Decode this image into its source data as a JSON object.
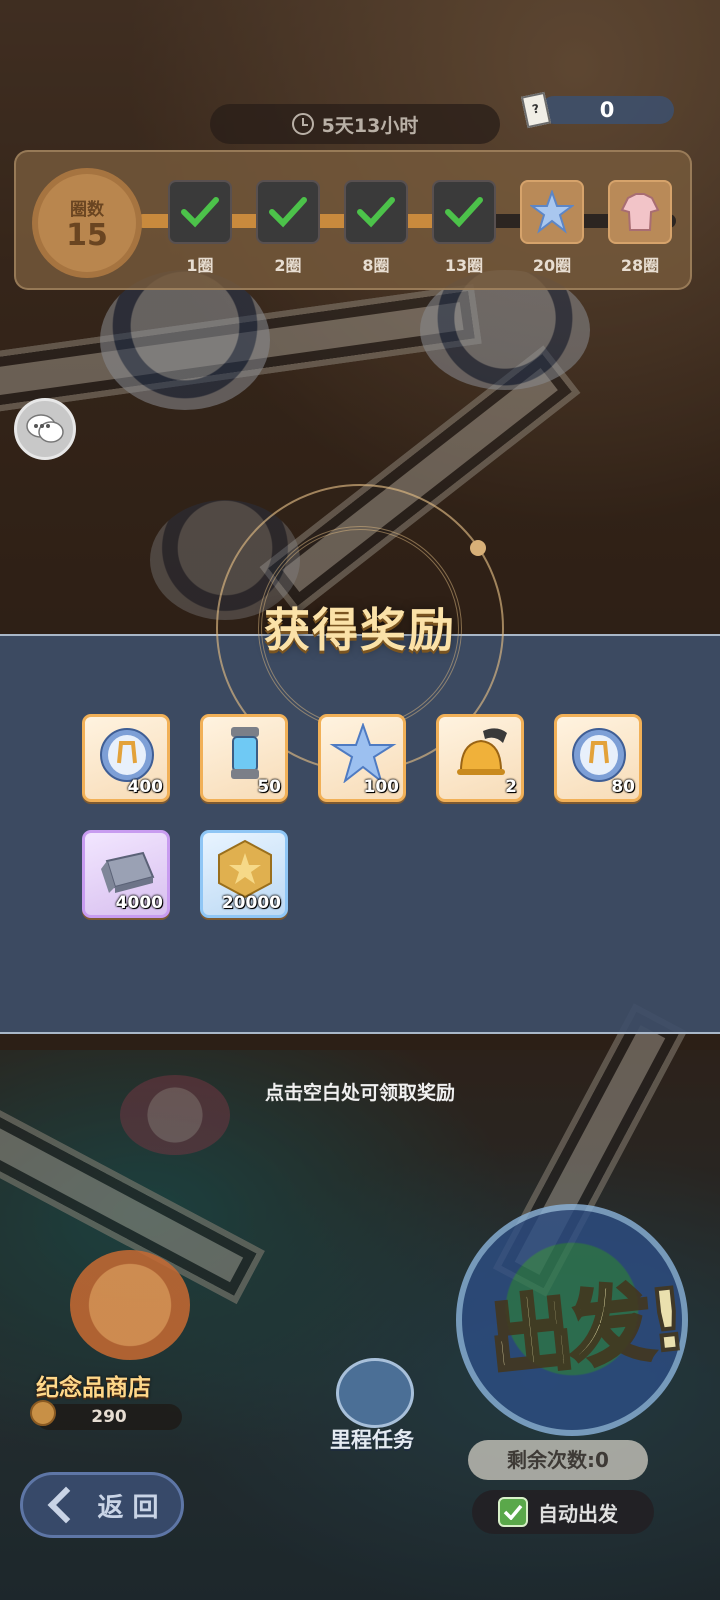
{
  "header": {
    "timer_text": "5天13小时",
    "ticket_count": "0",
    "ticket_icon_symbol": "?"
  },
  "lap_progress": {
    "badge_label": "圈数",
    "current_laps": "15",
    "milestones": [
      {
        "label": "1圈",
        "claimed": true
      },
      {
        "label": "2圈",
        "claimed": true
      },
      {
        "label": "8圈",
        "claimed": true
      },
      {
        "label": "13圈",
        "claimed": true
      },
      {
        "label": "20圈",
        "claimed": false,
        "icon": "star-crystal-icon"
      },
      {
        "label": "28圈",
        "claimed": false,
        "icon": "costume-icon"
      }
    ]
  },
  "reward_popup": {
    "title": "获得奖励",
    "items": [
      {
        "icon": "crystal-orb-icon",
        "quantity": "400",
        "rarity": "gold"
      },
      {
        "icon": "energy-canister-icon",
        "quantity": "50",
        "rarity": "gold"
      },
      {
        "icon": "star-crystal-icon",
        "quantity": "100",
        "rarity": "gold"
      },
      {
        "icon": "bell-icon",
        "quantity": "2",
        "rarity": "gold"
      },
      {
        "icon": "crystal-orb-icon",
        "quantity": "80",
        "rarity": "gold"
      },
      {
        "icon": "silver-ingot-icon",
        "quantity": "4000",
        "rarity": "purple"
      },
      {
        "icon": "gold-coin-icon",
        "quantity": "20000",
        "rarity": "blue"
      }
    ],
    "hint": "点击空白处可领取奖励"
  },
  "bottom": {
    "shop_label": "纪念品商店",
    "shop_coins": "290",
    "mission_label": "里程任务",
    "back_label": "返 回",
    "depart_label": "出发!",
    "remaining_label": "剩余次数:0",
    "auto_depart_label": "自动出发"
  },
  "colors": {
    "reward_band": "#3e4e68",
    "title_gold": "#fbe2a8",
    "check_green": "#4cc24a",
    "accent_orange": "#f1b057"
  }
}
